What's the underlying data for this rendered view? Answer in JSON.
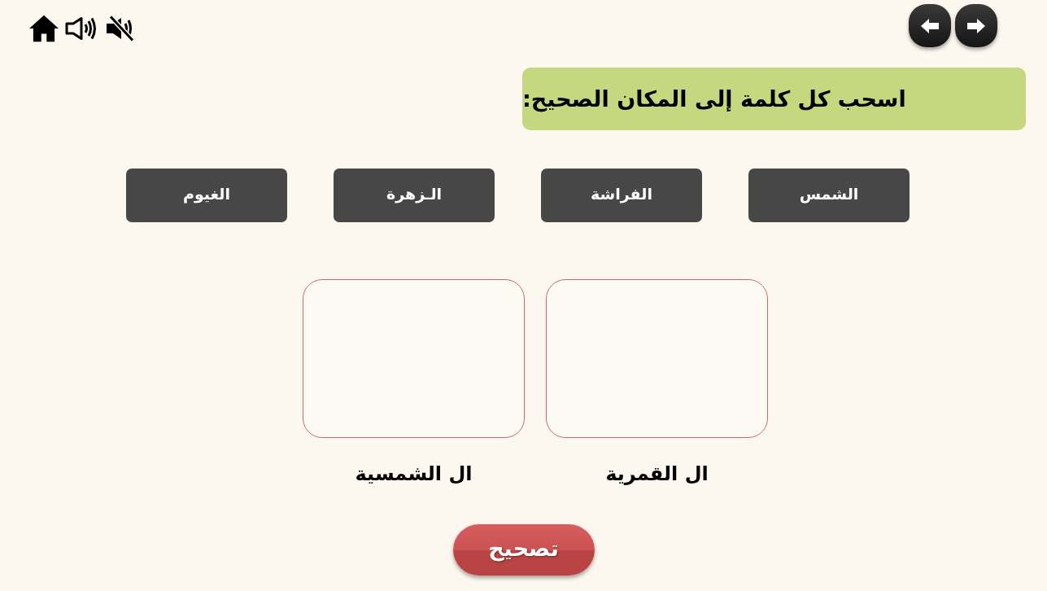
{
  "instruction": "اسحب كل كلمة إلى المكان الصحيح:",
  "words": [
    "الشمس",
    "الفراشة",
    "الـزهرة",
    "الغيوم"
  ],
  "drop_zones": [
    {
      "label": "ال القمرية"
    },
    {
      "label": "ال الشمسية"
    }
  ],
  "check_button": "تصحيح"
}
